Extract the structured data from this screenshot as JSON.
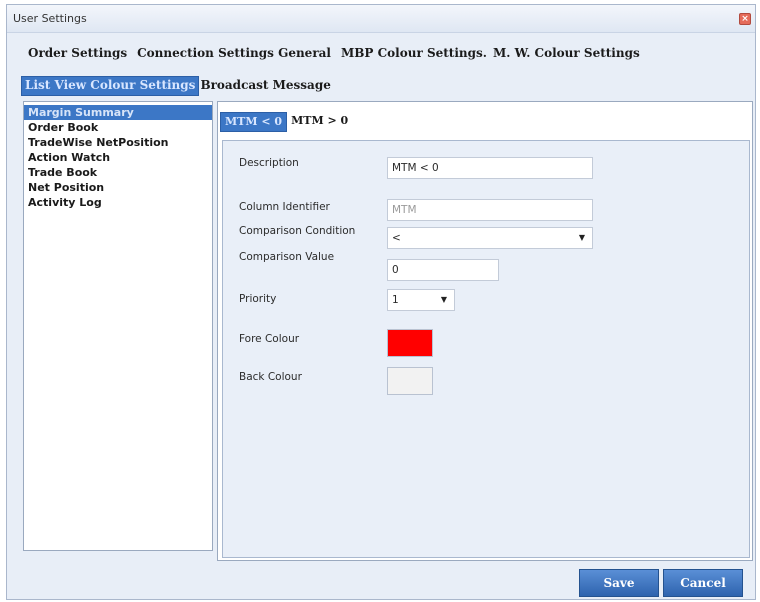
{
  "window": {
    "title": "User Settings",
    "close_glyph": "×"
  },
  "tabs_row1": [
    {
      "label": "Order Settings"
    },
    {
      "label": "Connection Settings General"
    },
    {
      "label": "MBP Colour Settings."
    },
    {
      "label": "M. W. Colour Settings"
    }
  ],
  "tabs_row2": [
    {
      "label": "List View Colour Settings",
      "active": true
    },
    {
      "label": "Broadcast Message",
      "active": false
    }
  ],
  "left_list": [
    {
      "label": "Margin Summary",
      "selected": true
    },
    {
      "label": "Order Book"
    },
    {
      "label": "TradeWise NetPosition"
    },
    {
      "label": "Action Watch"
    },
    {
      "label": "Trade Book"
    },
    {
      "label": "Net Position"
    },
    {
      "label": "Activity Log"
    }
  ],
  "subtabs": [
    {
      "label": "MTM < 0",
      "active": true
    },
    {
      "label": "MTM > 0",
      "active": false
    }
  ],
  "form": {
    "description_label": "Description",
    "description_value": "MTM < 0",
    "column_identifier_label": "Column Identifier",
    "column_identifier_value": "MTM",
    "comparison_condition_label": "Comparison Condition",
    "comparison_condition_value": "<",
    "comparison_value_label": "Comparison Value",
    "comparison_value_value": "0",
    "priority_label": "Priority",
    "priority_value": "1",
    "fore_colour_label": "Fore Colour",
    "fore_colour": "#ff0000",
    "back_colour_label": "Back Colour",
    "back_colour": "#f2f2f2"
  },
  "buttons": {
    "save": "Save",
    "cancel": "Cancel"
  },
  "icons": {
    "dropdown": "chevron-down-icon",
    "close": "close-icon"
  },
  "colors": {
    "accent": "#3c77c6",
    "window_bg": "#e8eef7"
  }
}
